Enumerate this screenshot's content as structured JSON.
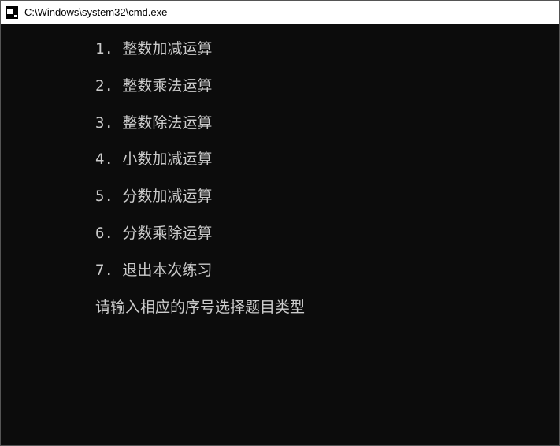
{
  "window": {
    "title": "C:\\Windows\\system32\\cmd.exe"
  },
  "menu": {
    "items": [
      "1. 整数加减运算",
      "2. 整数乘法运算",
      "3. 整数除法运算",
      "4. 小数加减运算",
      "5. 分数加减运算",
      "6. 分数乘除运算",
      "7. 退出本次练习"
    ],
    "prompt": "请输入相应的序号选择题目类型"
  }
}
